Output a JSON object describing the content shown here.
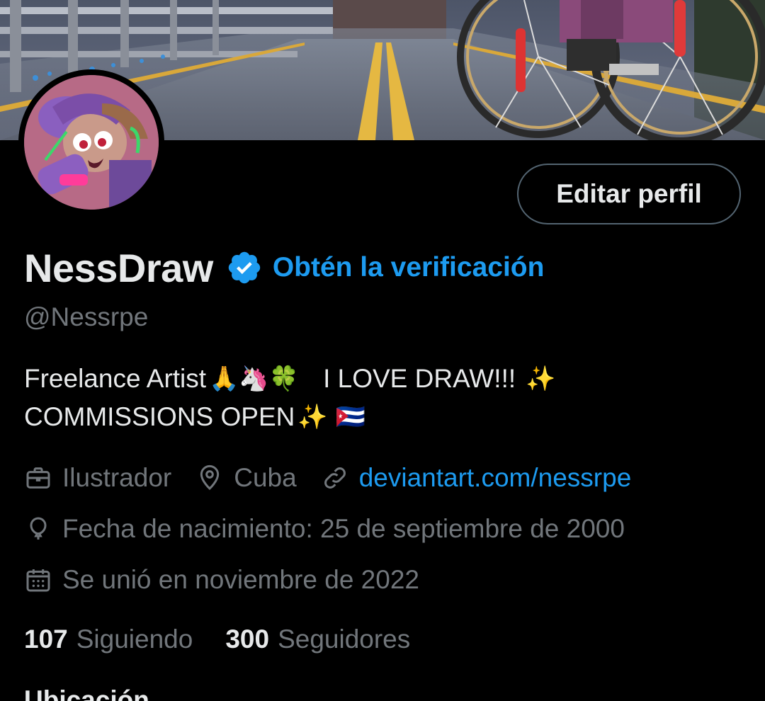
{
  "profile": {
    "display_name": "NessDraw",
    "verify_cta": "Obtén la verificación",
    "handle": "@Nessrpe",
    "edit_button": "Editar perfil"
  },
  "bio": {
    "line1_text": "Freelance Artist",
    "line1_emoji": "🙏🦄🍀",
    "line1_tail": "I LOVE DRAW!!!",
    "line1_tail_emoji": "✨",
    "line2_text": "COMMISSIONS OPEN",
    "line2_emoji": "✨ 🇨🇺"
  },
  "meta": {
    "profession": "Ilustrador",
    "location": "Cuba",
    "website": "deviantart.com/nessrpe",
    "birthday": "Fecha de nacimiento: 25 de septiembre de 2000",
    "joined": "Se unió en noviembre de 2022"
  },
  "icons": {
    "profession": "briefcase-icon",
    "location": "location-pin-icon",
    "website": "link-icon",
    "birthday": "balloon-icon",
    "joined": "calendar-icon",
    "verified": "verified-badge-icon"
  },
  "stats": {
    "following_count": "107",
    "following_label": "Siguiendo",
    "followers_count": "300",
    "followers_label": "Seguidores"
  },
  "next_section": "Ubicación",
  "colors": {
    "background": "#000000",
    "text_primary": "#e7e9ea",
    "text_secondary": "#71767b",
    "accent": "#1d9bf0",
    "button_border": "#536471"
  }
}
